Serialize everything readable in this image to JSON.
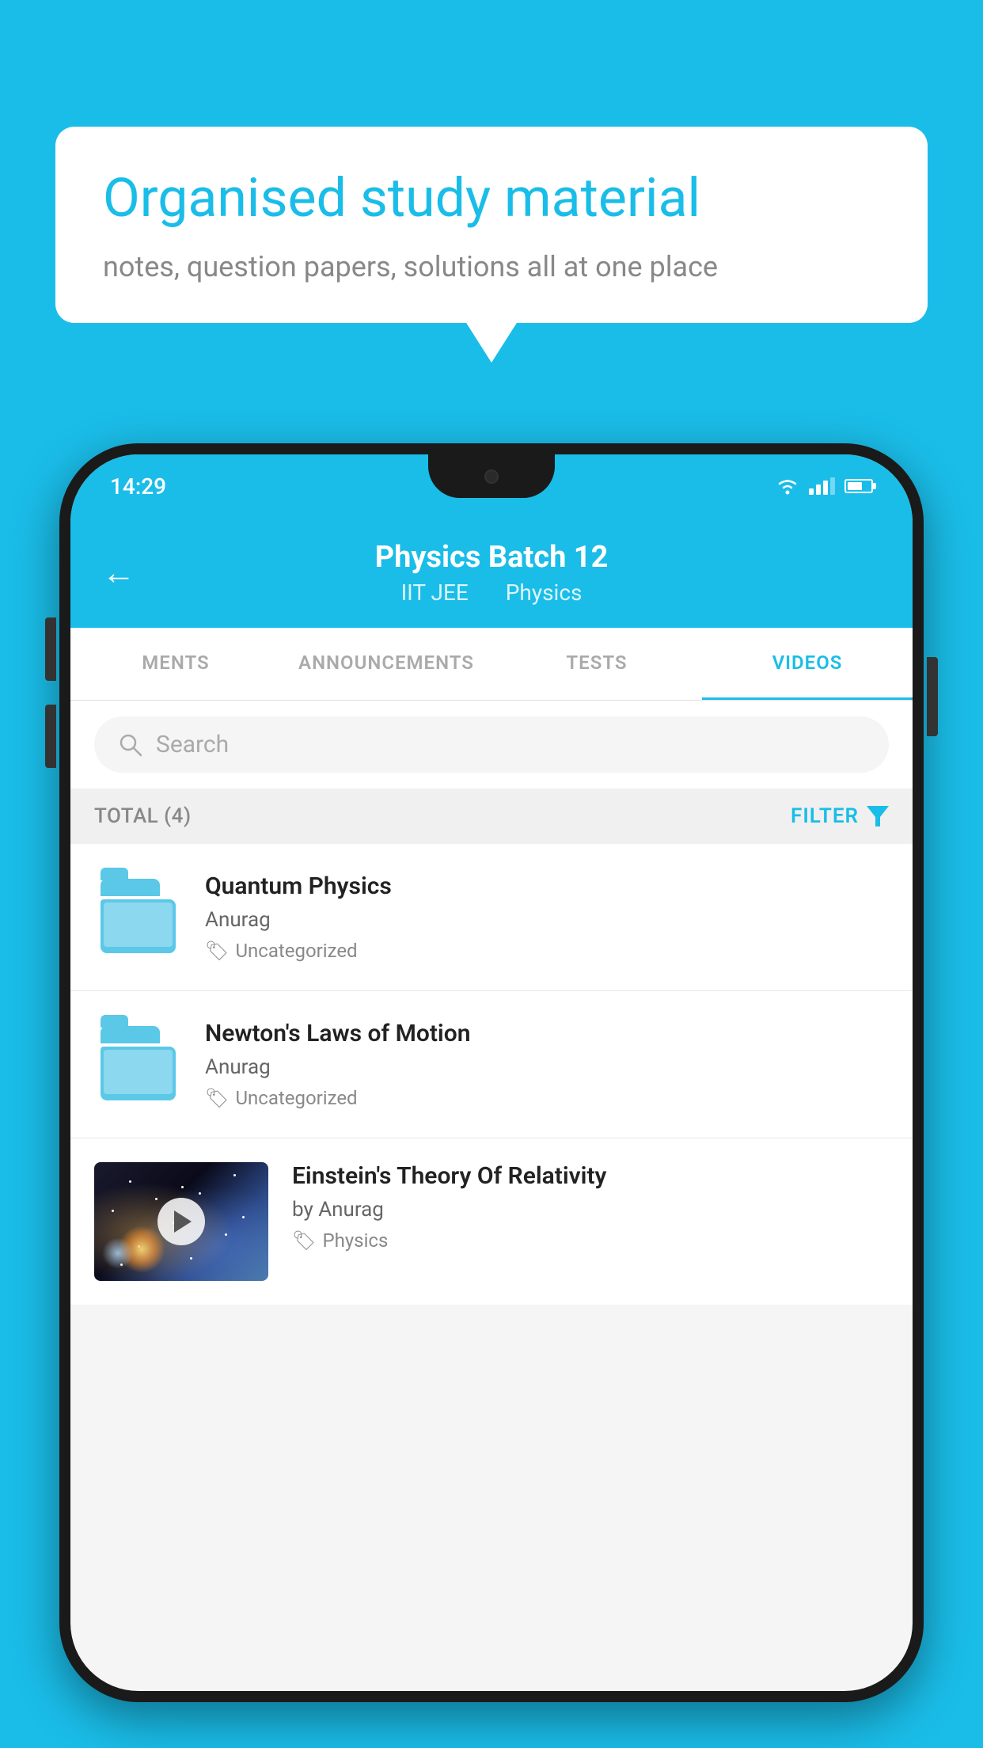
{
  "background_color": "#1ABDE8",
  "speech_bubble": {
    "title": "Organised study material",
    "subtitle": "notes, question papers, solutions all at one place"
  },
  "status_bar": {
    "time": "14:29"
  },
  "app_header": {
    "back_label": "←",
    "title": "Physics Batch 12",
    "subtitle_part1": "IIT JEE",
    "subtitle_part2": "Physics"
  },
  "tabs": [
    {
      "label": "MENTS",
      "active": false
    },
    {
      "label": "ANNOUNCEMENTS",
      "active": false
    },
    {
      "label": "TESTS",
      "active": false
    },
    {
      "label": "VIDEOS",
      "active": true
    }
  ],
  "search": {
    "placeholder": "Search"
  },
  "filter_bar": {
    "total_label": "TOTAL (4)",
    "filter_label": "FILTER"
  },
  "videos": [
    {
      "id": 1,
      "title": "Quantum Physics",
      "author": "Anurag",
      "tag": "Uncategorized",
      "type": "folder",
      "has_thumbnail": false
    },
    {
      "id": 2,
      "title": "Newton's Laws of Motion",
      "author": "Anurag",
      "tag": "Uncategorized",
      "type": "folder",
      "has_thumbnail": false
    },
    {
      "id": 3,
      "title": "Einstein's Theory Of Relativity",
      "author": "by Anurag",
      "tag": "Physics",
      "type": "video",
      "has_thumbnail": true
    }
  ]
}
